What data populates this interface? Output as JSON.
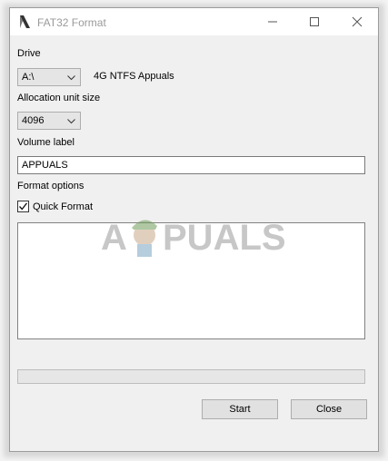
{
  "window": {
    "title": "FAT32 Format"
  },
  "drive": {
    "label": "Drive",
    "selected": "A:\\",
    "description": "4G NTFS Appuals"
  },
  "allocation": {
    "label": "Allocation unit size",
    "selected": "4096"
  },
  "volume": {
    "label": "Volume label",
    "value": "APPUALS"
  },
  "options": {
    "label": "Format options",
    "quick_format_label": "Quick Format",
    "quick_format_checked": true
  },
  "progress": {
    "value": 0
  },
  "buttons": {
    "start": "Start",
    "close": "Close"
  },
  "watermark": {
    "text": "PUALS",
    "prefix": "A"
  },
  "icons": {
    "app": "app-icon",
    "minimize": "minimize-icon",
    "maximize": "maximize-icon",
    "close": "close-icon",
    "dropdown": "chevron-down-icon",
    "check": "check-icon"
  }
}
